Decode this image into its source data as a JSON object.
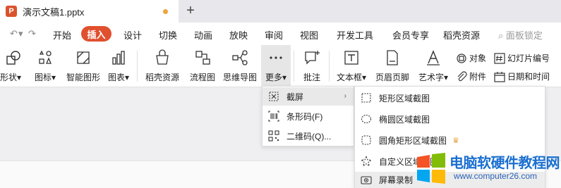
{
  "tabbar": {
    "doc_logo": "P",
    "doc_title": "演示文稿1.pptx",
    "new_tab": "+"
  },
  "quick_access": {
    "undo": "↶",
    "redo": "↷",
    "more": "▾"
  },
  "menu": {
    "items": [
      "开始",
      "插入",
      "设计",
      "切换",
      "动画",
      "放映",
      "审阅",
      "视图",
      "开发工具",
      "会员专享",
      "稻壳资源"
    ],
    "active": "插入",
    "lock": "面板锁定"
  },
  "ribbon": {
    "shape": "形状",
    "icons": "图标",
    "smart": "智能图形",
    "chart": "图表",
    "docer": "稻壳资源",
    "flow": "流程图",
    "mind": "思维导图",
    "more": "更多",
    "comment": "批注",
    "textbox": "文本框",
    "header_footer": "页眉页脚",
    "wordart": "艺术字",
    "object": "对象",
    "slide_number": "幻灯片编号",
    "attachment": "附件",
    "datetime": "日期和时间",
    "dropdown_caret": "▾"
  },
  "more_menu": {
    "items": [
      {
        "label": "截屏",
        "icon": "screenshot-icon"
      },
      {
        "label": "条形码(F)",
        "icon": "barcode-icon"
      },
      {
        "label": "二维码(Q)...",
        "icon": "qrcode-icon"
      }
    ],
    "submenu_arrow": "›"
  },
  "screenshot_submenu": {
    "items": [
      {
        "label": "矩形区域截图",
        "icon": "rect-select-icon"
      },
      {
        "label": "椭圆区域截图",
        "icon": "ellipse-select-icon"
      },
      {
        "label": "圆角矩形区域截图",
        "icon": "rounded-rect-select-icon"
      },
      {
        "label": "自定义区域截图",
        "icon": "star-select-icon"
      },
      {
        "label": "屏幕录制",
        "icon": "screen-record-icon"
      }
    ],
    "crown": "♛"
  },
  "watermark": {
    "title": "电脑软硬件教程网",
    "url": "www.computer26.com"
  },
  "colors": {
    "accent": "#e0502e",
    "watermark_blue": "#1a6fd0"
  }
}
